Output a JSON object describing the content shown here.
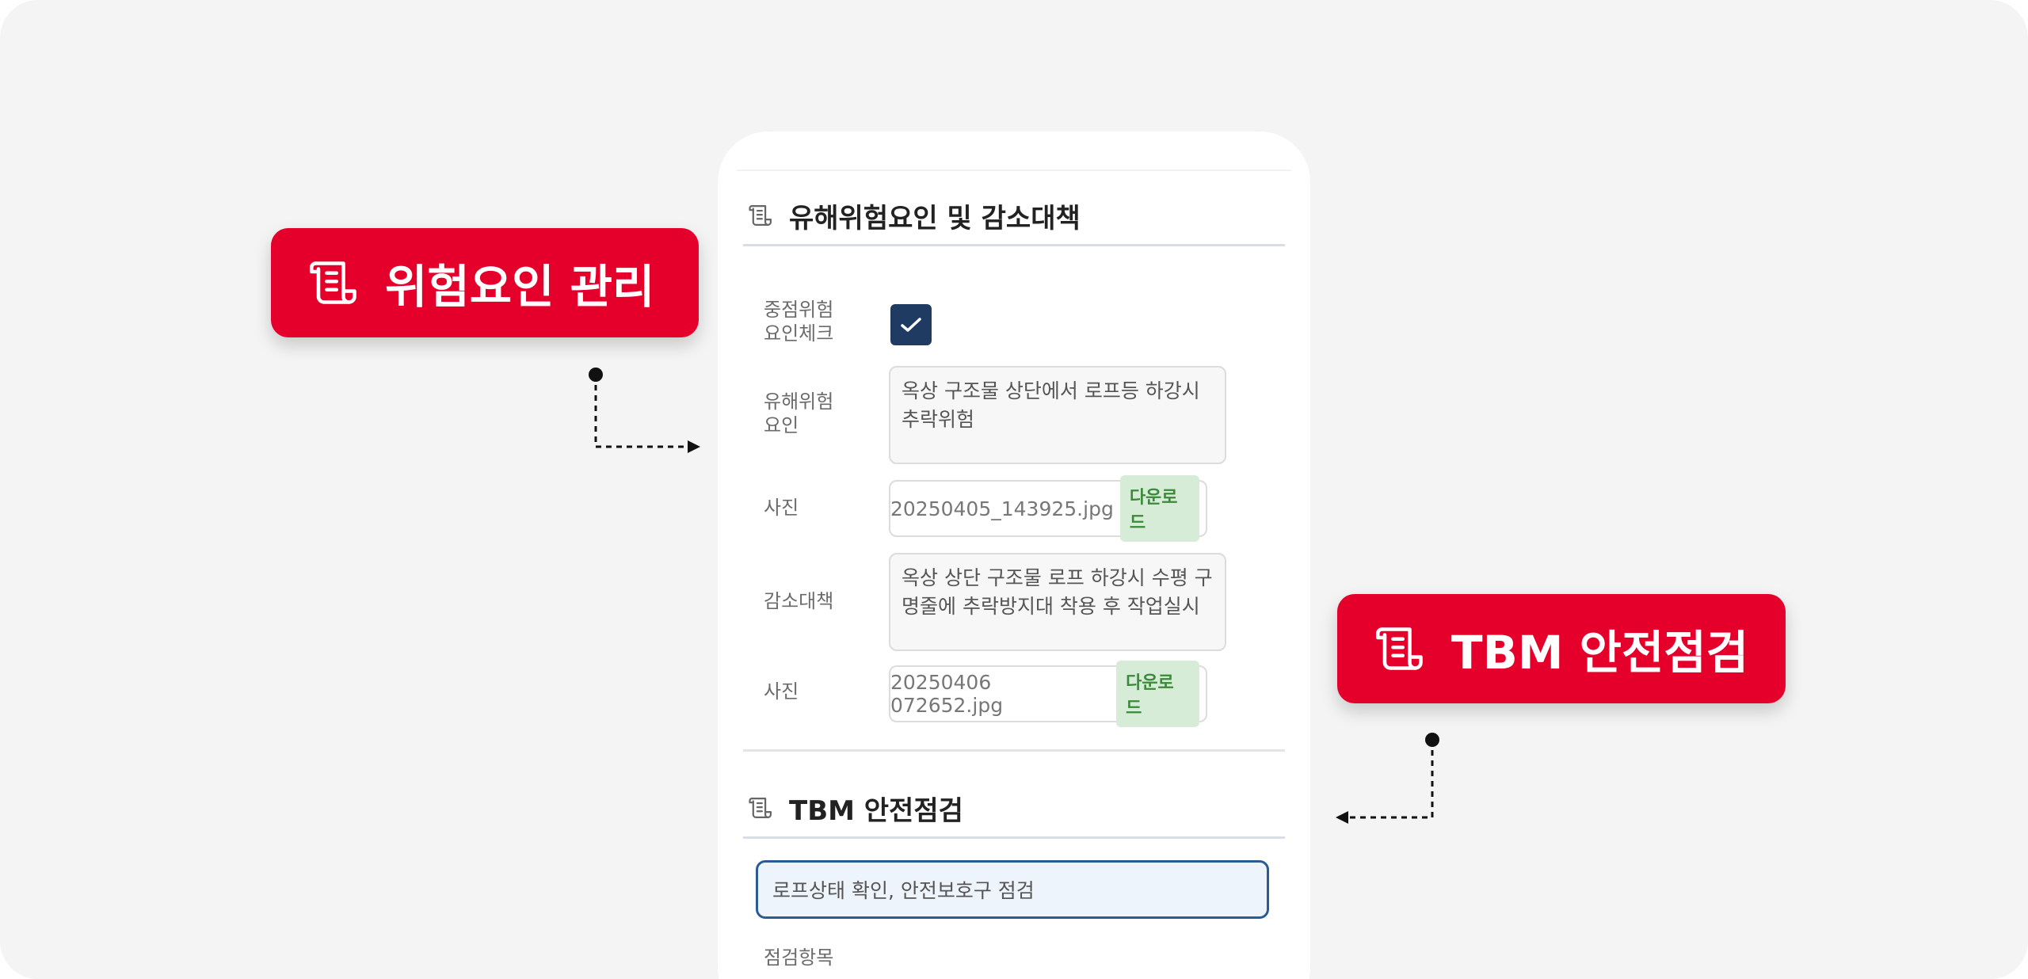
{
  "callouts": {
    "risk": {
      "label": "위험요인 관리",
      "icon": "scroll-document-icon"
    },
    "tbm": {
      "label": "TBM 안전점검",
      "icon": "scroll-document-icon"
    }
  },
  "hazard_section": {
    "title": "유해위험요인 및 감소대책",
    "icon": "scroll-document-icon",
    "check_label": "중점위험\n요인체크",
    "checked": true,
    "hazard_label": "유해위험\n요인",
    "hazard_value": "옥상 구조물 상단에서 로프등 하강시 추락위험",
    "photo1_label": "사진",
    "photo1_file": "20250405_143925.jpg",
    "download_label": "다운로드",
    "measure_label": "감소대책",
    "measure_value": "옥상 상단 구조물 로프 하강시 수평 구명줄에 추락방지대 착용 후 작업실시",
    "photo2_label": "사진",
    "photo2_file": "20250406 072652.jpg"
  },
  "tbm_section": {
    "title": "TBM 안전점검",
    "icon": "scroll-document-icon",
    "input_value": "로프상태 확인, 안전보호구 점검",
    "next_label": "점검항목"
  },
  "colors": {
    "accent_red": "#e4002b",
    "navy": "#1f3b62",
    "download_green": "#3a8a3a"
  }
}
